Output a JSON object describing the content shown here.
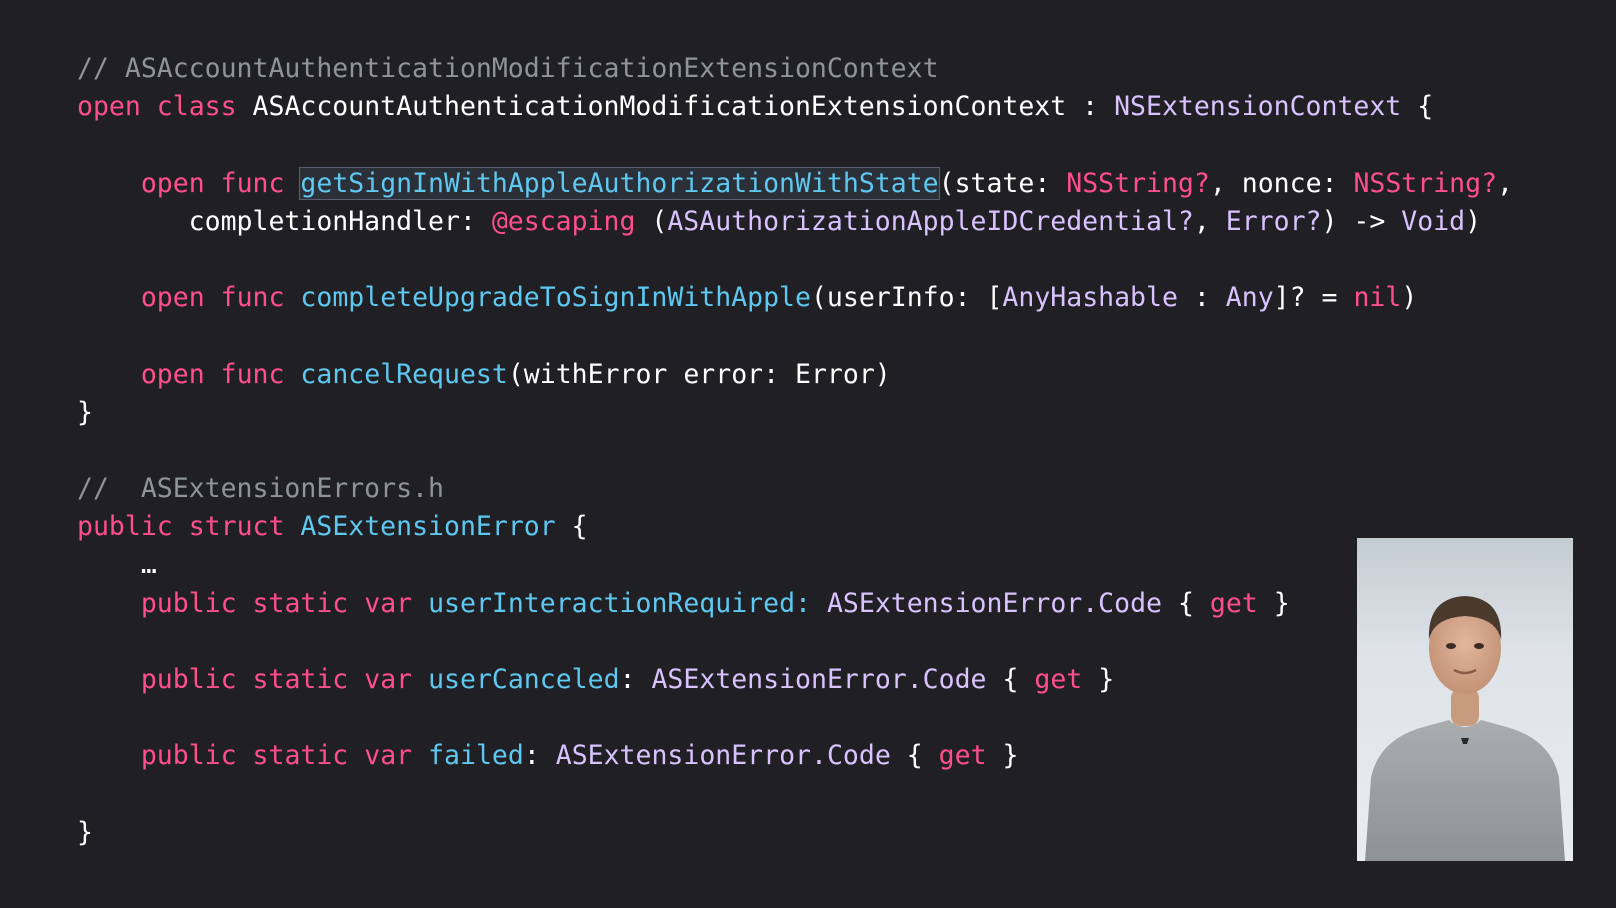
{
  "slide": {
    "code_lines": [
      [
        {
          "t": "// ASAccountAuthenticationModificationExtensionContext",
          "k": "comment"
        }
      ],
      [
        {
          "t": "open",
          "k": "keyword"
        },
        {
          "t": " ",
          "k": "plain"
        },
        {
          "t": "class",
          "k": "keyword"
        },
        {
          "t": " ASAccountAuthenticationModificationExtensionContext : ",
          "k": "plain"
        },
        {
          "t": "NSExtensionContext",
          "k": "type"
        },
        {
          "t": " {",
          "k": "plain"
        }
      ],
      [],
      [
        {
          "t": "    ",
          "k": "plain"
        },
        {
          "t": "open",
          "k": "keyword"
        },
        {
          "t": " ",
          "k": "plain"
        },
        {
          "t": "func",
          "k": "keyword"
        },
        {
          "t": " ",
          "k": "plain"
        },
        {
          "t": "getSignInWithAppleAuthorizationWithState",
          "k": "func",
          "selected": true
        },
        {
          "t": "(state: ",
          "k": "plain"
        },
        {
          "t": "NSString?",
          "k": "keyword"
        },
        {
          "t": ", nonce: ",
          "k": "plain"
        },
        {
          "t": "NSString?",
          "k": "keyword"
        },
        {
          "t": ",",
          "k": "plain"
        }
      ],
      [
        {
          "t": "       completionHandler: ",
          "k": "plain"
        },
        {
          "t": "@escaping",
          "k": "keyword"
        },
        {
          "t": " (",
          "k": "plain"
        },
        {
          "t": "ASAuthorizationAppleIDCredential?",
          "k": "type"
        },
        {
          "t": ", ",
          "k": "plain"
        },
        {
          "t": "Error?",
          "k": "type"
        },
        {
          "t": ") -> ",
          "k": "plain"
        },
        {
          "t": "Void",
          "k": "type"
        },
        {
          "t": ")",
          "k": "plain"
        }
      ],
      [],
      [
        {
          "t": "    ",
          "k": "plain"
        },
        {
          "t": "open",
          "k": "keyword"
        },
        {
          "t": " ",
          "k": "plain"
        },
        {
          "t": "func",
          "k": "keyword"
        },
        {
          "t": " ",
          "k": "plain"
        },
        {
          "t": "completeUpgradeToSignInWithApple",
          "k": "func"
        },
        {
          "t": "(userInfo: [",
          "k": "plain"
        },
        {
          "t": "AnyHashable",
          "k": "type"
        },
        {
          "t": " : ",
          "k": "plain"
        },
        {
          "t": "Any",
          "k": "type"
        },
        {
          "t": "]? = ",
          "k": "plain"
        },
        {
          "t": "nil",
          "k": "keyword"
        },
        {
          "t": ")",
          "k": "plain"
        }
      ],
      [],
      [
        {
          "t": "    ",
          "k": "plain"
        },
        {
          "t": "open",
          "k": "keyword"
        },
        {
          "t": " ",
          "k": "plain"
        },
        {
          "t": "func",
          "k": "keyword"
        },
        {
          "t": " ",
          "k": "plain"
        },
        {
          "t": "cancelRequest",
          "k": "func"
        },
        {
          "t": "(withError error: Error)",
          "k": "plain"
        }
      ],
      [
        {
          "t": "}",
          "k": "plain"
        }
      ],
      [],
      [
        {
          "t": "//  ASExtensionErrors.h",
          "k": "comment"
        }
      ],
      [
        {
          "t": "public",
          "k": "keyword"
        },
        {
          "t": " ",
          "k": "plain"
        },
        {
          "t": "struct",
          "k": "keyword"
        },
        {
          "t": " ",
          "k": "plain"
        },
        {
          "t": "ASExtensionError",
          "k": "func"
        },
        {
          "t": " {",
          "k": "plain"
        }
      ],
      [
        {
          "t": "    …",
          "k": "plain"
        }
      ],
      [
        {
          "t": "    ",
          "k": "plain"
        },
        {
          "t": "public",
          "k": "keyword"
        },
        {
          "t": " ",
          "k": "plain"
        },
        {
          "t": "static",
          "k": "keyword"
        },
        {
          "t": " ",
          "k": "plain"
        },
        {
          "t": "var",
          "k": "keyword"
        },
        {
          "t": " ",
          "k": "plain"
        },
        {
          "t": "userInteractionRequired:",
          "k": "func"
        },
        {
          "t": " ",
          "k": "plain"
        },
        {
          "t": "ASExtensionError.Code",
          "k": "type"
        },
        {
          "t": " { ",
          "k": "plain"
        },
        {
          "t": "get",
          "k": "keyword"
        },
        {
          "t": " }",
          "k": "plain"
        }
      ],
      [],
      [
        {
          "t": "    ",
          "k": "plain"
        },
        {
          "t": "public",
          "k": "keyword"
        },
        {
          "t": " ",
          "k": "plain"
        },
        {
          "t": "static",
          "k": "keyword"
        },
        {
          "t": " ",
          "k": "plain"
        },
        {
          "t": "var",
          "k": "keyword"
        },
        {
          "t": " ",
          "k": "plain"
        },
        {
          "t": "userCanceled",
          "k": "func"
        },
        {
          "t": ": ",
          "k": "plain"
        },
        {
          "t": "ASExtensionError.Code",
          "k": "type"
        },
        {
          "t": " { ",
          "k": "plain"
        },
        {
          "t": "get",
          "k": "keyword"
        },
        {
          "t": " }",
          "k": "plain"
        }
      ],
      [],
      [
        {
          "t": "    ",
          "k": "plain"
        },
        {
          "t": "public",
          "k": "keyword"
        },
        {
          "t": " ",
          "k": "plain"
        },
        {
          "t": "static",
          "k": "keyword"
        },
        {
          "t": " ",
          "k": "plain"
        },
        {
          "t": "var",
          "k": "keyword"
        },
        {
          "t": " ",
          "k": "plain"
        },
        {
          "t": "failed",
          "k": "func"
        },
        {
          "t": ": ",
          "k": "plain"
        },
        {
          "t": "ASExtensionError.Code",
          "k": "type"
        },
        {
          "t": " { ",
          "k": "plain"
        },
        {
          "t": "get",
          "k": "keyword"
        },
        {
          "t": " }",
          "k": "plain"
        }
      ],
      [],
      [
        {
          "t": "}",
          "k": "plain"
        }
      ]
    ],
    "colors": {
      "background": "#1f1f24",
      "comment": "#8f949a",
      "keyword": "#ff4f8b",
      "type": "#d9c3ff",
      "func": "#5ec8f0",
      "plain": "#ffffff"
    }
  },
  "presenter_video": {
    "icon": "presenter-video-thumbnail"
  }
}
